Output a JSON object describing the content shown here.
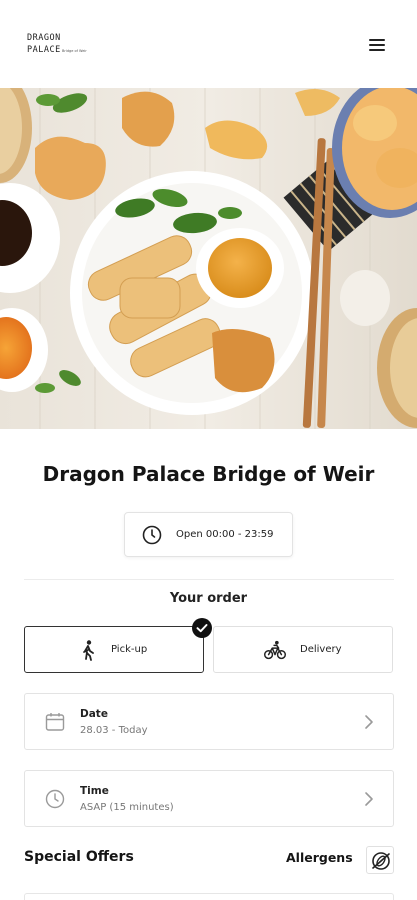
{
  "header": {
    "logo_line1": "DRAGON",
    "logo_line2": "PALACE",
    "logo_sub": "Bridge of Weir",
    "menu_icon": "hamburger-menu-icon"
  },
  "hero": {
    "alt": "Spring rolls with dipping sauce, dumplings and chopsticks"
  },
  "restaurant": {
    "name": "Dragon Palace Bridge of Weir",
    "hours": "Open 00:00 - 23:59",
    "hours_icon": "clock-icon"
  },
  "order": {
    "title": "Your order",
    "modes": [
      {
        "label": "Pick-up",
        "icon": "walking-person-icon",
        "selected": true
      },
      {
        "label": "Delivery",
        "icon": "bicycle-icon",
        "selected": false
      }
    ],
    "date": {
      "label": "Date",
      "value": "28.03 - Today",
      "icon": "calendar-icon"
    },
    "time": {
      "label": "Time",
      "value": "ASAP (15 minutes)",
      "icon": "clock-icon"
    }
  },
  "sections": {
    "special_offers": "Special Offers",
    "allergens": "Allergens",
    "allergens_icon": "no-allergen-icon"
  },
  "colors": {
    "text": "#151515",
    "border": "#e3e3e3",
    "badge": "#111111"
  }
}
